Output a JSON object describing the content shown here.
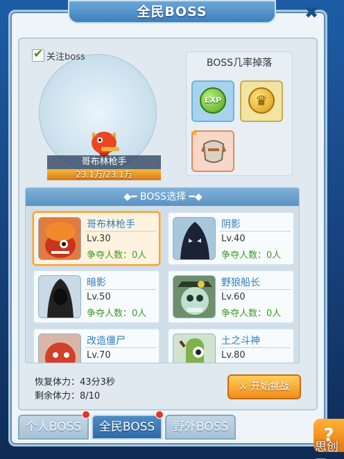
{
  "window": {
    "title": "全民BOSS",
    "close_label": "✖"
  },
  "follow": {
    "label": "关注boss",
    "checked": true
  },
  "featured_boss": {
    "name": "哥布林枪手",
    "hp_text": "23.1万/23.1万"
  },
  "drops": {
    "title": "BOSS几率掉落",
    "items": [
      "EXP",
      "gold-coin-icon",
      "armor-icon"
    ],
    "exp_label": "EXP"
  },
  "select": {
    "header": "BOSS选择",
    "bosses": [
      {
        "name": "哥布林枪手",
        "level": "Lv.30",
        "contenders": "争夺人数：0人",
        "selected": true
      },
      {
        "name": "阴影",
        "level": "Lv.40",
        "contenders": "争夺人数：0人"
      },
      {
        "name": "暗影",
        "level": "Lv.50",
        "contenders": "争夺人数：0人"
      },
      {
        "name": "野狼船长",
        "level": "Lv.60",
        "contenders": "争夺人数：0人"
      },
      {
        "name": "改造僵尸",
        "level": "Lv.70"
      },
      {
        "name": "土之斗神",
        "level": "Lv.80"
      }
    ]
  },
  "status": {
    "recover": "恢复体力：43分3秒",
    "remaining": "剩余体力：8/10"
  },
  "start_button": "开始挑战",
  "tabs": [
    {
      "label": "个人BOSS",
      "badge": true
    },
    {
      "label": "全民BOSS",
      "badge": true,
      "active": true
    },
    {
      "label": "野外BOSS",
      "badge": false
    }
  ],
  "watermark": "思创网",
  "colors": {
    "accent": "#f08c1b",
    "selected_border": "#f2a23c",
    "contend_green": "#3c9a25",
    "name_blue": "#2e7fc1"
  }
}
